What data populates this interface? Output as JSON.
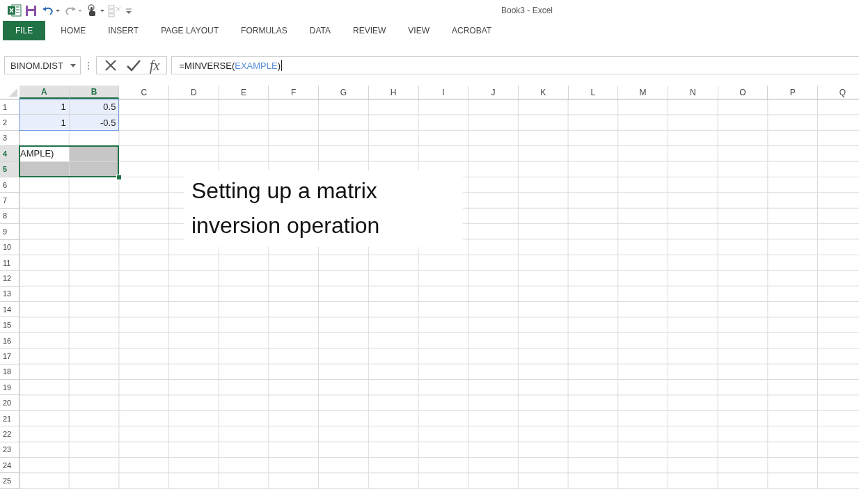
{
  "window": {
    "title": "Book3 - Excel"
  },
  "ribbon_tabs": [
    {
      "label": "FILE",
      "kind": "file"
    },
    {
      "label": "HOME",
      "kind": "tab"
    },
    {
      "label": "INSERT",
      "kind": "tab"
    },
    {
      "label": "PAGE LAYOUT",
      "kind": "tab"
    },
    {
      "label": "FORMULAS",
      "kind": "tab"
    },
    {
      "label": "DATA",
      "kind": "tab"
    },
    {
      "label": "REVIEW",
      "kind": "tab"
    },
    {
      "label": "VIEW",
      "kind": "tab"
    },
    {
      "label": "ACROBAT",
      "kind": "tab"
    }
  ],
  "formula_bar": {
    "name_box": "BINOM.DIST",
    "insert_function": "fx",
    "formula": {
      "prefix": "=MINVERSE(",
      "reference": "EXAMPLE",
      "suffix": ")"
    }
  },
  "columns": [
    {
      "label": "A",
      "selected": true
    },
    {
      "label": "B",
      "selected": true
    },
    {
      "label": "C",
      "selected": false
    },
    {
      "label": "D",
      "selected": false
    },
    {
      "label": "E",
      "selected": false
    },
    {
      "label": "F",
      "selected": false
    },
    {
      "label": "G",
      "selected": false
    },
    {
      "label": "H",
      "selected": false
    },
    {
      "label": "I",
      "selected": false
    },
    {
      "label": "J",
      "selected": false
    },
    {
      "label": "K",
      "selected": false
    },
    {
      "label": "L",
      "selected": false
    },
    {
      "label": "M",
      "selected": false
    },
    {
      "label": "N",
      "selected": false
    },
    {
      "label": "O",
      "selected": false
    },
    {
      "label": "P",
      "selected": false
    },
    {
      "label": "Q",
      "selected": false
    }
  ],
  "rows": [
    {
      "header": "1",
      "selected": false,
      "cells": [
        {
          "value": "1",
          "kind": "referenced"
        },
        {
          "value": "0.5",
          "kind": "referenced"
        }
      ]
    },
    {
      "header": "2",
      "selected": false,
      "cells": [
        {
          "value": "1",
          "kind": "referenced"
        },
        {
          "value": "-0.5",
          "kind": "referenced"
        }
      ]
    },
    {
      "header": "3",
      "selected": false
    },
    {
      "header": "4",
      "selected": true,
      "cells": [
        {
          "value": "AMPLE)",
          "kind": "editing"
        },
        {
          "kind": "array"
        }
      ]
    },
    {
      "header": "5",
      "selected": true,
      "cells": [
        {
          "kind": "array"
        },
        {
          "kind": "array"
        }
      ]
    },
    {
      "header": "6",
      "selected": false
    },
    {
      "header": "7",
      "selected": false
    },
    {
      "header": "8",
      "selected": false
    },
    {
      "header": "9",
      "selected": false
    },
    {
      "header": "10",
      "selected": false
    },
    {
      "header": "11",
      "selected": false
    },
    {
      "header": "12",
      "selected": false
    },
    {
      "header": "13",
      "selected": false
    },
    {
      "header": "14",
      "selected": false
    },
    {
      "header": "15",
      "selected": false
    },
    {
      "header": "16",
      "selected": false
    },
    {
      "header": "17",
      "selected": false
    },
    {
      "header": "18",
      "selected": false
    },
    {
      "header": "19",
      "selected": false
    },
    {
      "header": "20",
      "selected": false
    },
    {
      "header": "21",
      "selected": false
    },
    {
      "header": "22",
      "selected": false
    },
    {
      "header": "23",
      "selected": false
    },
    {
      "header": "24",
      "selected": false
    },
    {
      "header": "25",
      "selected": false
    }
  ],
  "callout": {
    "lines": [
      "Setting up a matrix",
      "inversion operation"
    ]
  }
}
